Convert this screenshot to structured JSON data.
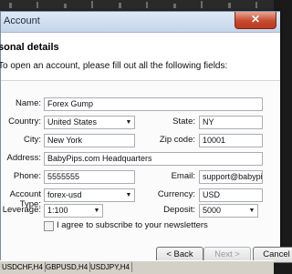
{
  "window": {
    "title": "Account",
    "close_glyph": "✕"
  },
  "header": {
    "title": "sonal details",
    "subtitle": "To open an account, please fill out all the following fields:"
  },
  "form": {
    "name": {
      "label": "Name:",
      "value": "Forex Gump"
    },
    "country": {
      "label": "Country:",
      "value": "United States"
    },
    "state": {
      "label": "State:",
      "value": "NY"
    },
    "city": {
      "label": "City:",
      "value": "New York"
    },
    "zip": {
      "label": "Zip code:",
      "value": "10001"
    },
    "address": {
      "label": "Address:",
      "value": "BabyPips.com Headquarters"
    },
    "phone": {
      "label": "Phone:",
      "value": "5555555"
    },
    "email": {
      "label": "Email:",
      "value": "support@babypips.com"
    },
    "account_type": {
      "label": "Account Type:",
      "value": "forex-usd"
    },
    "currency": {
      "label": "Currency:",
      "value": "USD"
    },
    "leverage": {
      "label": "Leverage:",
      "value": "1:100"
    },
    "deposit": {
      "label": "Deposit:",
      "value": "5000"
    },
    "newsletter": {
      "label": "I agree to subscribe to your newsletters",
      "checked": false
    }
  },
  "buttons": {
    "back": "< Back",
    "next": "Next >",
    "cancel": "Cancel"
  },
  "taskbar": {
    "tabs": [
      "USDCHF,H4",
      "GBPUSD,H4",
      "USDJPY,H4"
    ]
  },
  "colors": {
    "titlebar": "#c4d5ea",
    "close": "#c74a2e",
    "chart_bg": "#000000"
  },
  "icons": {
    "dropdown": "chevron-down-icon",
    "close": "close-icon"
  }
}
